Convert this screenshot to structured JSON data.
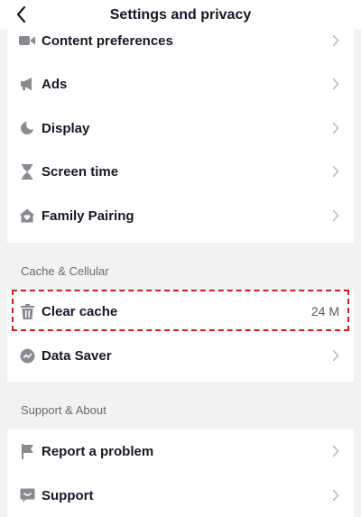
{
  "header": {
    "title": "Settings and privacy"
  },
  "sections": {
    "cache": "Cache & Cellular",
    "support": "Support & About"
  },
  "rows": {
    "content_preferences": "Content preferences",
    "ads": "Ads",
    "display": "Display",
    "screen_time": "Screen time",
    "family_pairing": "Family Pairing",
    "clear_cache": "Clear cache",
    "clear_cache_value": "24 M",
    "data_saver": "Data Saver",
    "report_problem": "Report a problem",
    "support": "Support"
  },
  "icons": {
    "back": "chevron-left-icon",
    "content_preferences": "video-camera-icon",
    "ads": "megaphone-icon",
    "display": "moon-icon",
    "screen_time": "hourglass-icon",
    "family_pairing": "home-heart-icon",
    "clear_cache": "trash-icon",
    "data_saver": "data-saver-icon",
    "report_problem": "flag-icon",
    "support": "support-chat-icon",
    "chevron": "chevron-right-icon"
  },
  "colors": {
    "highlight_border": "#d61b1b",
    "icon_gray": "#8a8b91",
    "chevron_gray": "#b8b8bd"
  }
}
